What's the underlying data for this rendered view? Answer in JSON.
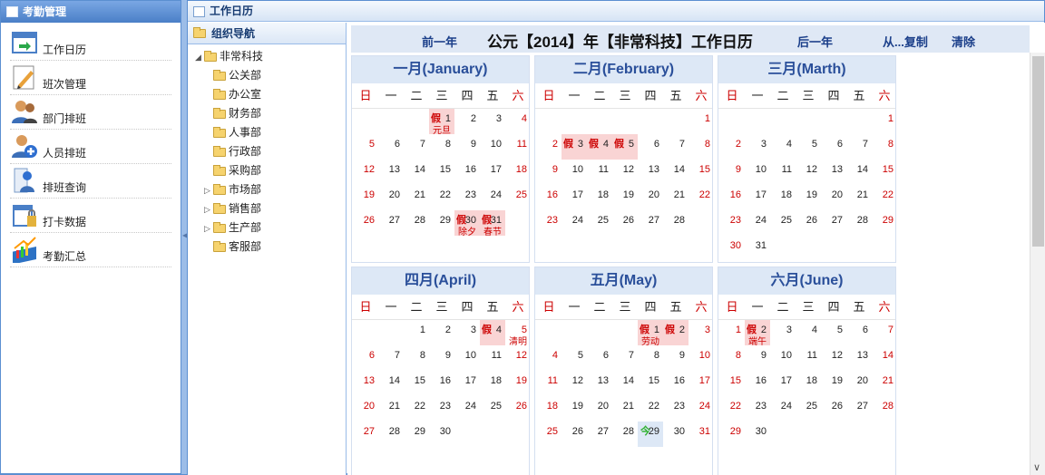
{
  "left_panel": {
    "title": "考勤管理",
    "menu": [
      {
        "label": "工作日历",
        "icon": "calendar-icon"
      },
      {
        "label": "班次管理",
        "icon": "edit-icon"
      },
      {
        "label": "部门排班",
        "icon": "users-icon"
      },
      {
        "label": "人员排班",
        "icon": "add-user-icon"
      },
      {
        "label": "排班查询",
        "icon": "search-user-icon"
      },
      {
        "label": "打卡数据",
        "icon": "clock-card-icon"
      },
      {
        "label": "考勤汇总",
        "icon": "chart-icon"
      }
    ]
  },
  "right_panel": {
    "title": "工作日历"
  },
  "tree": {
    "header": "组织导航",
    "root": "非常科技",
    "nodes": [
      {
        "label": "公关部",
        "expandable": false
      },
      {
        "label": "办公室",
        "expandable": false
      },
      {
        "label": "财务部",
        "expandable": false
      },
      {
        "label": "人事部",
        "expandable": false
      },
      {
        "label": "行政部",
        "expandable": false
      },
      {
        "label": "采购部",
        "expandable": false
      },
      {
        "label": "市场部",
        "expandable": true
      },
      {
        "label": "销售部",
        "expandable": true
      },
      {
        "label": "生产部",
        "expandable": true
      },
      {
        "label": "客服部",
        "expandable": false
      }
    ]
  },
  "calendar": {
    "prev_label": "前一年",
    "title": "公元【2014】年【非常科技】工作日历",
    "next_label": "后一年",
    "copy_label": "从...复制",
    "clear_label": "清除",
    "weekdays": [
      "日",
      "一",
      "二",
      "三",
      "四",
      "五",
      "六"
    ],
    "holiday_mark": "假",
    "today_mark": "今",
    "months": [
      {
        "name": "一月(January)",
        "start": 3,
        "days": 31,
        "holidays": [
          1,
          30,
          31
        ],
        "festivals": {
          "1": "元旦",
          "30": "除夕",
          "31": "春节"
        }
      },
      {
        "name": "二月(February)",
        "start": 6,
        "days": 28,
        "holidays": [
          3,
          4,
          5
        ],
        "festivals": {}
      },
      {
        "name": "三月(Marth)",
        "start": 6,
        "days": 31,
        "holidays": [],
        "festivals": {}
      },
      {
        "name": "四月(April)",
        "start": 2,
        "days": 30,
        "holidays": [
          4
        ],
        "festivals": {
          "5": "清明"
        }
      },
      {
        "name": "五月(May)",
        "start": 4,
        "days": 31,
        "holidays": [
          1,
          2
        ],
        "festivals": {
          "1": "劳动"
        },
        "today": 29
      },
      {
        "name": "六月(June)",
        "start": 0,
        "days": 30,
        "holidays": [
          2
        ],
        "festivals": {
          "2": "端午"
        }
      }
    ]
  }
}
